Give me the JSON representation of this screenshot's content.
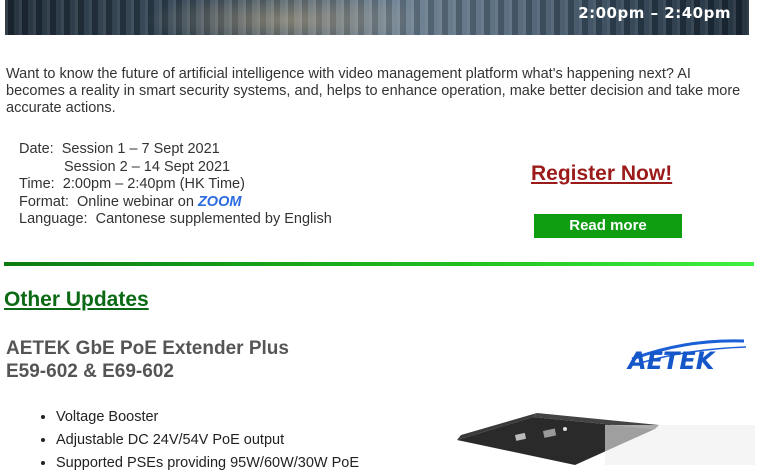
{
  "banner": {
    "time_text": "2:00pm – 2:40pm"
  },
  "intro": "Want to know the future of artificial intelligence with video management platform what's happening next? AI becomes a reality in smart security systems, and, helps to enhance operation, make better decision and take more accurate actions.",
  "event": {
    "date_label": "Date:",
    "session1": "Session 1 – 7 Sept 2021",
    "session2": "Session 2 – 14 Sept 2021",
    "time_label": "Time:",
    "time_value": "2:00pm – 2:40pm (HK Time)",
    "format_label": "Format:",
    "format_value": "Online webinar on",
    "format_platform": "ZOOM",
    "language_label": "Language:",
    "language_value": "Cantonese supplemented by English"
  },
  "actions": {
    "register": "Register Now!",
    "read_more": "Read more"
  },
  "other_updates": {
    "title": "Other Updates",
    "product_line1": "AETEK GbE PoE Extender Plus",
    "product_line2": "E59-602 & E69-602",
    "logo_text": "AETEK",
    "features": [
      "Voltage Booster",
      "Adjustable DC 24V/54V PoE output",
      "Supported PSEs providing 95W/60W/30W PoE"
    ]
  },
  "colors": {
    "register": "#9b1b1b",
    "read_more_bg": "#0f9d12",
    "section_title": "#0c6a15",
    "zoom": "#2d6be0"
  }
}
